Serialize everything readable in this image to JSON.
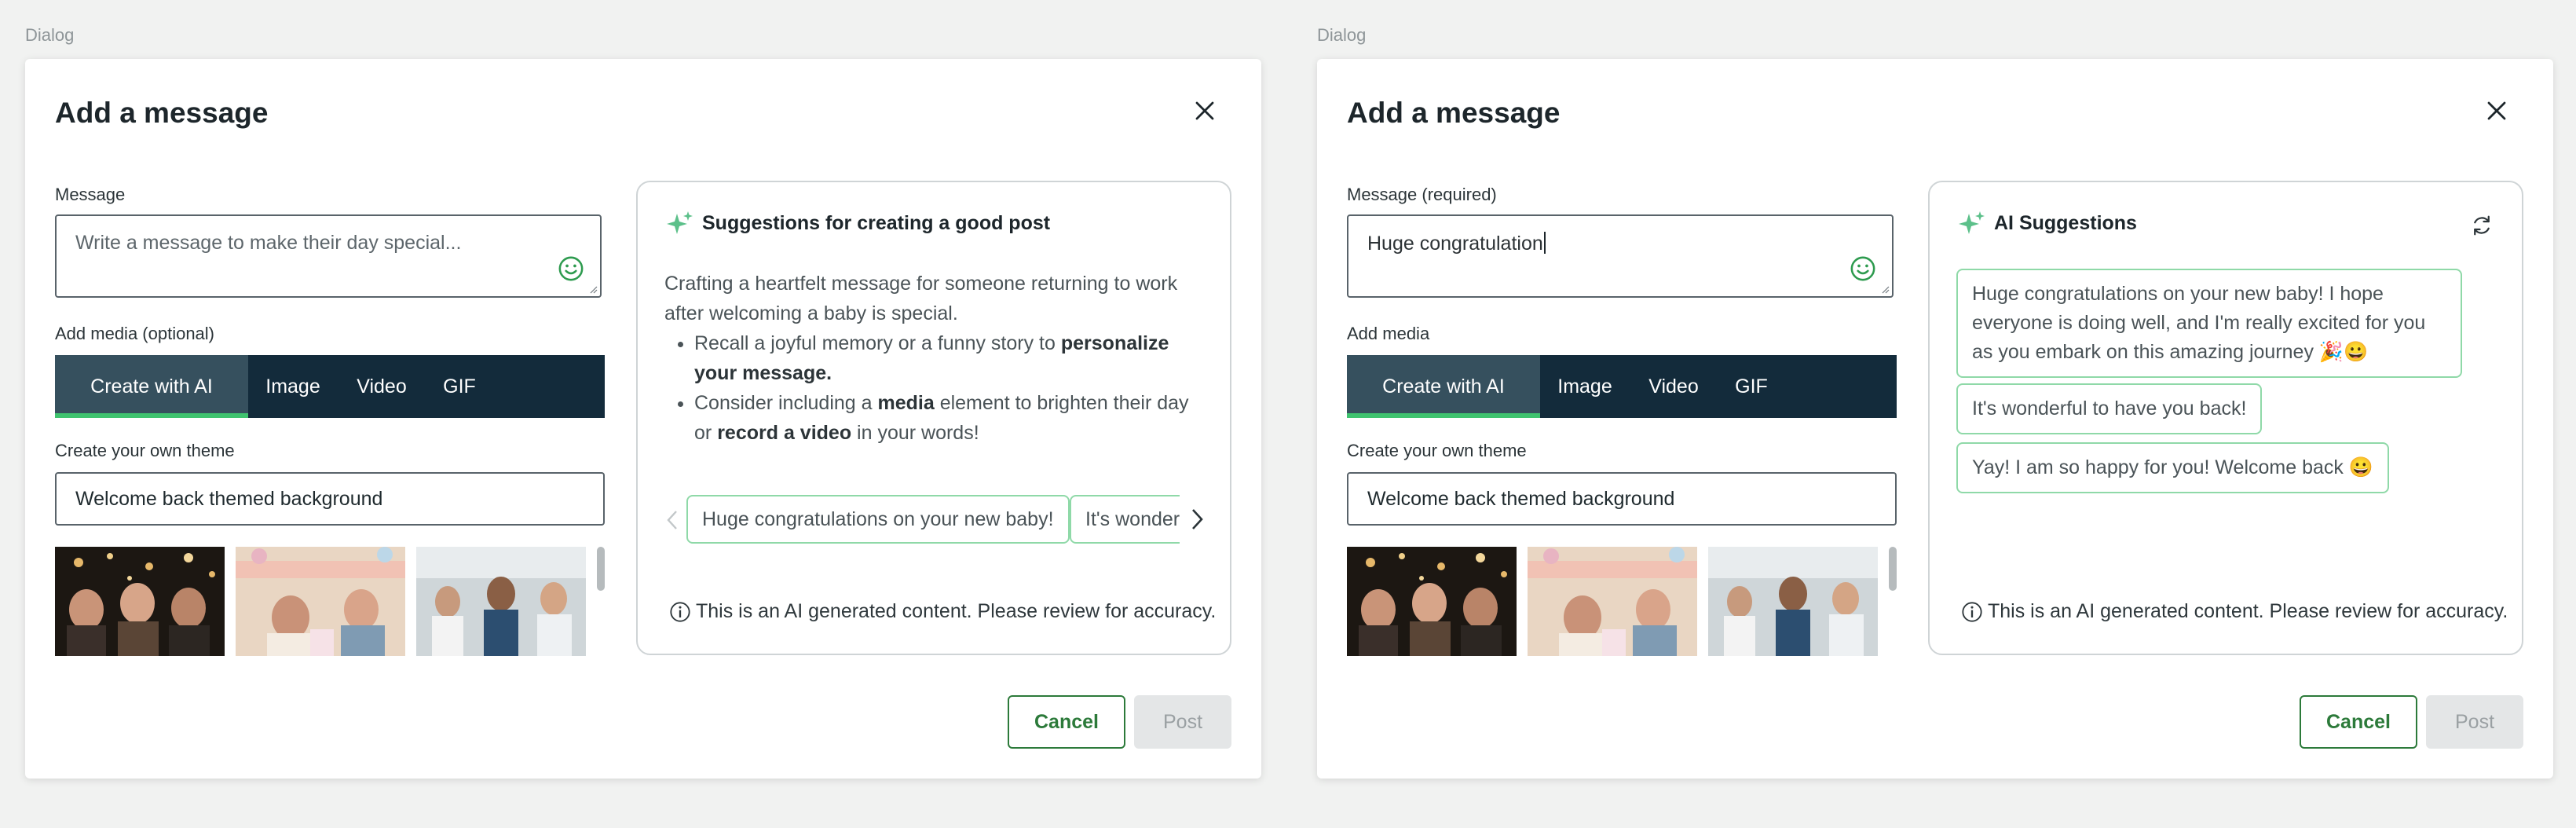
{
  "frames": [
    {
      "frame_label": "Dialog",
      "title": "Add a message",
      "message_label": "Message",
      "message_placeholder": "Write a message to make their day special...",
      "media_label": "Add media (optional)",
      "tabs": [
        "Create with AI",
        "Image",
        "Video",
        "GIF"
      ],
      "theme_label": "Create your own theme",
      "theme_value": "Welcome back themed background",
      "panel": {
        "title": "Suggestions for creating a good post",
        "intro": "Crafting a heartfelt message for someone returning to work after welcoming a baby is special.",
        "tip1_pre": "Recall a joyful memory or a funny story to ",
        "tip1_bold": "personalize your message.",
        "tip2_pre": "Consider including a ",
        "tip2_bold1": "media",
        "tip2_mid": " element to brighten their day or ",
        "tip2_bold2": "record a video",
        "tip2_post": " in your words!",
        "chips": [
          "Huge congratulations on your new baby!",
          "It's wonderful to have you back!"
        ],
        "disclaimer": "This is an AI generated content. Please review for accuracy."
      },
      "cancel_label": "Cancel",
      "post_label": "Post"
    },
    {
      "frame_label": "Dialog",
      "title": "Add a message",
      "message_label": "Message (required)",
      "message_value": "Huge congratulation",
      "media_label": "Add media",
      "tabs": [
        "Create with AI",
        "Image",
        "Video",
        "GIF"
      ],
      "theme_label": "Create your own theme",
      "theme_value": "Welcome back themed background",
      "panel": {
        "title": "AI Suggestions",
        "suggestions": [
          "Huge congratulations on your new baby! I hope everyone is doing well, and I'm really excited for you as you embark on this amazing journey 🎉😀",
          "It's wonderful to have you back!",
          "Yay! I am so happy for you! Welcome back 😀"
        ],
        "disclaimer": "This is an AI generated content. Please review for accuracy."
      },
      "cancel_label": "Cancel",
      "post_label": "Post"
    }
  ],
  "colors": {
    "tab_bar": "#132b3b",
    "tab_active": "#36505e",
    "active_underline": "#3fc36f",
    "chip_border": "#8fd9a8",
    "primary_green": "#2c7a3a"
  }
}
